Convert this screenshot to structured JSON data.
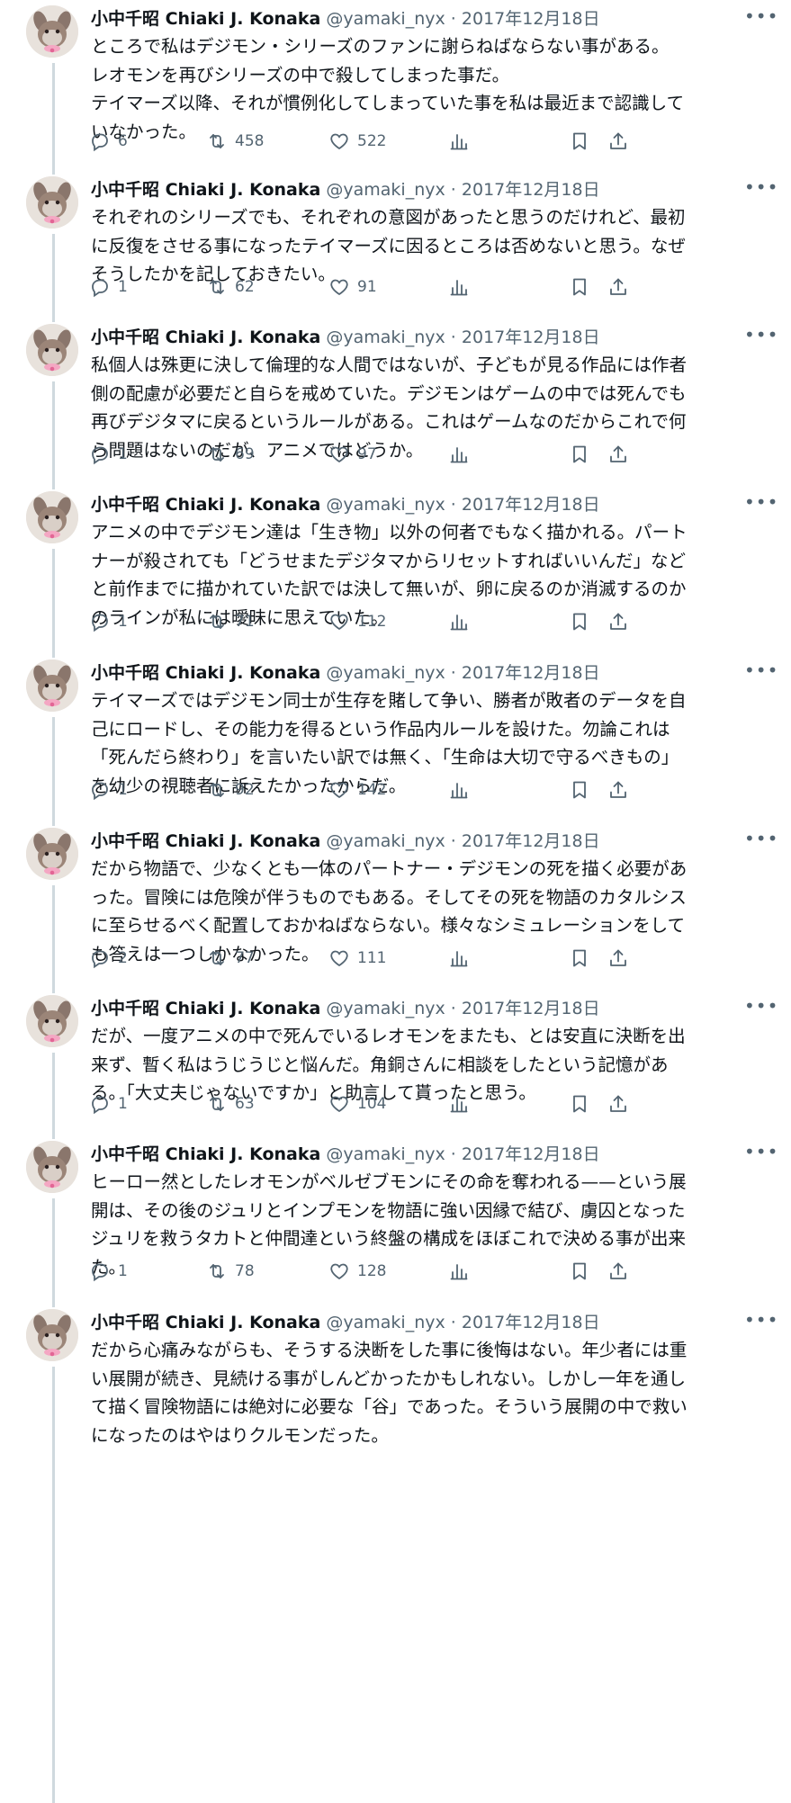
{
  "author": {
    "name": "小中千昭 Chiaki J. Konaka",
    "handle": "@yamaki_nyx",
    "separator": "·"
  },
  "icons": {
    "reply": "reply-icon",
    "retweet": "retweet-icon",
    "like": "heart-icon",
    "views": "views-icon",
    "bookmark": "bookmark-icon",
    "share": "share-icon",
    "more": "more-icon"
  },
  "tweets": [
    {
      "date": "2017年12月18日",
      "text": "ところで私はデジモン・シリーズのファンに謝らねばならない事がある。\nレオモンを再びシリーズの中で殺してしまった事だ。\nテイマーズ以降、それが慣例化してしまっていた事を私は最近まで認識して\nいなかった。",
      "replies": "6",
      "retweets": "458",
      "likes": "522"
    },
    {
      "date": "2017年12月18日",
      "text": "それぞれのシリーズでも、それぞれの意図があったと思うのだけれど、最初\nに反復をさせる事になったテイマーズに因るところは否めないと思う。なぜ\nそうしたかを記しておきたい。",
      "replies": "1",
      "retweets": "62",
      "likes": "91"
    },
    {
      "date": "2017年12月18日",
      "text": "私個人は殊更に決して倫理的な人間ではないが、子どもが見る作品には作者\n側の配慮が必要だと自らを戒めていた。デジモンはゲームの中では死んでも\n再びデジタマに戻るというルールがある。これはゲームなのだからこれで何\nら問題はないのだが、アニメではどうか。",
      "replies": "1",
      "retweets": "69",
      "likes": "97"
    },
    {
      "date": "2017年12月18日",
      "text": "アニメの中でデジモン達は「生き物」以外の何者でもなく描かれる。パート\nナーが殺されても「どうせまたデジタマからリセットすればいいんだ」など\nと前作までに描かれていた訳では決して無いが、卵に戻るのか消滅するのか\nのラインが私には曖昧に思えていた。",
      "replies": "1",
      "retweets": "71",
      "likes": "112"
    },
    {
      "date": "2017年12月18日",
      "text": "テイマーズではデジモン同士が生存を賭して争い、勝者が敗者のデータを自\n己にロードし、その能力を得るという作品内ルールを設けた。勿論これは\n「死んだら終わり」を言いたい訳では無く、「生命は大切で守るべきもの」\nを幼少の視聴者に訴えたかったからだ。",
      "replies": "1",
      "retweets": "92",
      "likes": "142"
    },
    {
      "date": "2017年12月18日",
      "text": "だから物語で、少なくとも一体のパートナー・デジモンの死を描く必要があ\nった。冒険には危険が伴うものでもある。そしてその死を物語のカタルシス\nに至らせるべく配置しておかねばならない。様々なシミュレーションをして\nも答えは一つしかなかった。",
      "replies": "2",
      "retweets": "77",
      "likes": "111"
    },
    {
      "date": "2017年12月18日",
      "text": "だが、一度アニメの中で死んでいるレオモンをまたも、とは安直に決断を出\n来ず、暫く私はうじうじと悩んだ。角銅さんに相談をしたという記憶があ\nる。「大丈夫じゃないですか」と助言して貰ったと思う。",
      "replies": "1",
      "retweets": "63",
      "likes": "104"
    },
    {
      "date": "2017年12月18日",
      "text": "ヒーロー然としたレオモンがベルゼブモンにその命を奪われる——という展\n開は、その後のジュリとインプモンを物語に強い因縁で結び、虜囚となった\nジュリを救うタカトと仲間達という終盤の構成をほぼこれで決める事が出来\nた。",
      "replies": "1",
      "retweets": "78",
      "likes": "128"
    },
    {
      "date": "2017年12月18日",
      "text": "だから心痛みながらも、そうする決断をした事に後悔はない。年少者には重\nい展開が続き、見続ける事がしんどかったかもしれない。しかし一年を通し\nて描く冒険物語には絶対に必要な「谷」であった。そういう展開の中で救い\nになったのはやはりクルモンだった。",
      "replies": "",
      "retweets": "",
      "likes": ""
    }
  ]
}
